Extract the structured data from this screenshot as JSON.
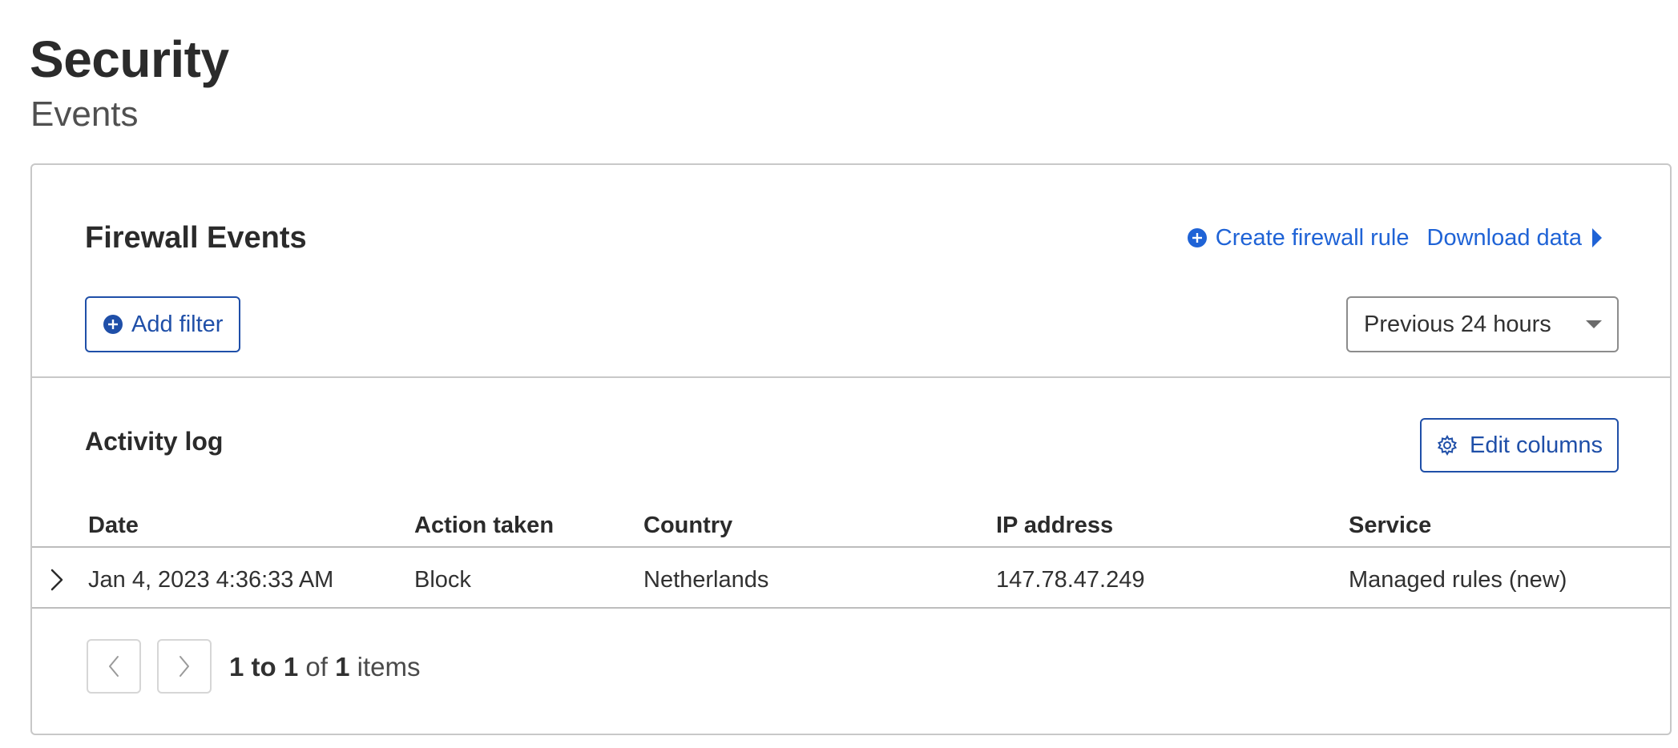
{
  "page": {
    "title": "Security",
    "subtitle": "Events"
  },
  "card": {
    "title": "Firewall Events",
    "actions": {
      "create_rule_label": "Create firewall rule",
      "download_label": "Download data"
    },
    "add_filter_label": "Add filter",
    "time_range": {
      "selected": "Previous 24 hours"
    }
  },
  "activity_log": {
    "title": "Activity log",
    "edit_columns_label": "Edit columns",
    "columns": [
      "Date",
      "Action taken",
      "Country",
      "IP address",
      "Service"
    ],
    "rows": [
      {
        "date": "Jan 4, 2023 4:36:33 AM",
        "action": "Block",
        "country": "Netherlands",
        "ip": "147.78.47.249",
        "service": "Managed rules (new)"
      }
    ]
  },
  "pagination": {
    "range": "1 to 1",
    "of_label": "of",
    "total": "1",
    "items_label": "items"
  },
  "colors": {
    "link_blue": "#1f63d6",
    "button_blue": "#1f4fa8",
    "text": "#313131",
    "border": "#c8c8c8"
  },
  "icons": {
    "create_rule": "plus-circle-icon",
    "download": "caret-right-icon",
    "add_filter": "plus-circle-icon",
    "time_select": "caret-down-icon",
    "edit_columns": "gear-icon",
    "row_expand": "chevron-right-icon",
    "pager_prev": "chevron-left-icon",
    "pager_next": "chevron-right-icon"
  }
}
